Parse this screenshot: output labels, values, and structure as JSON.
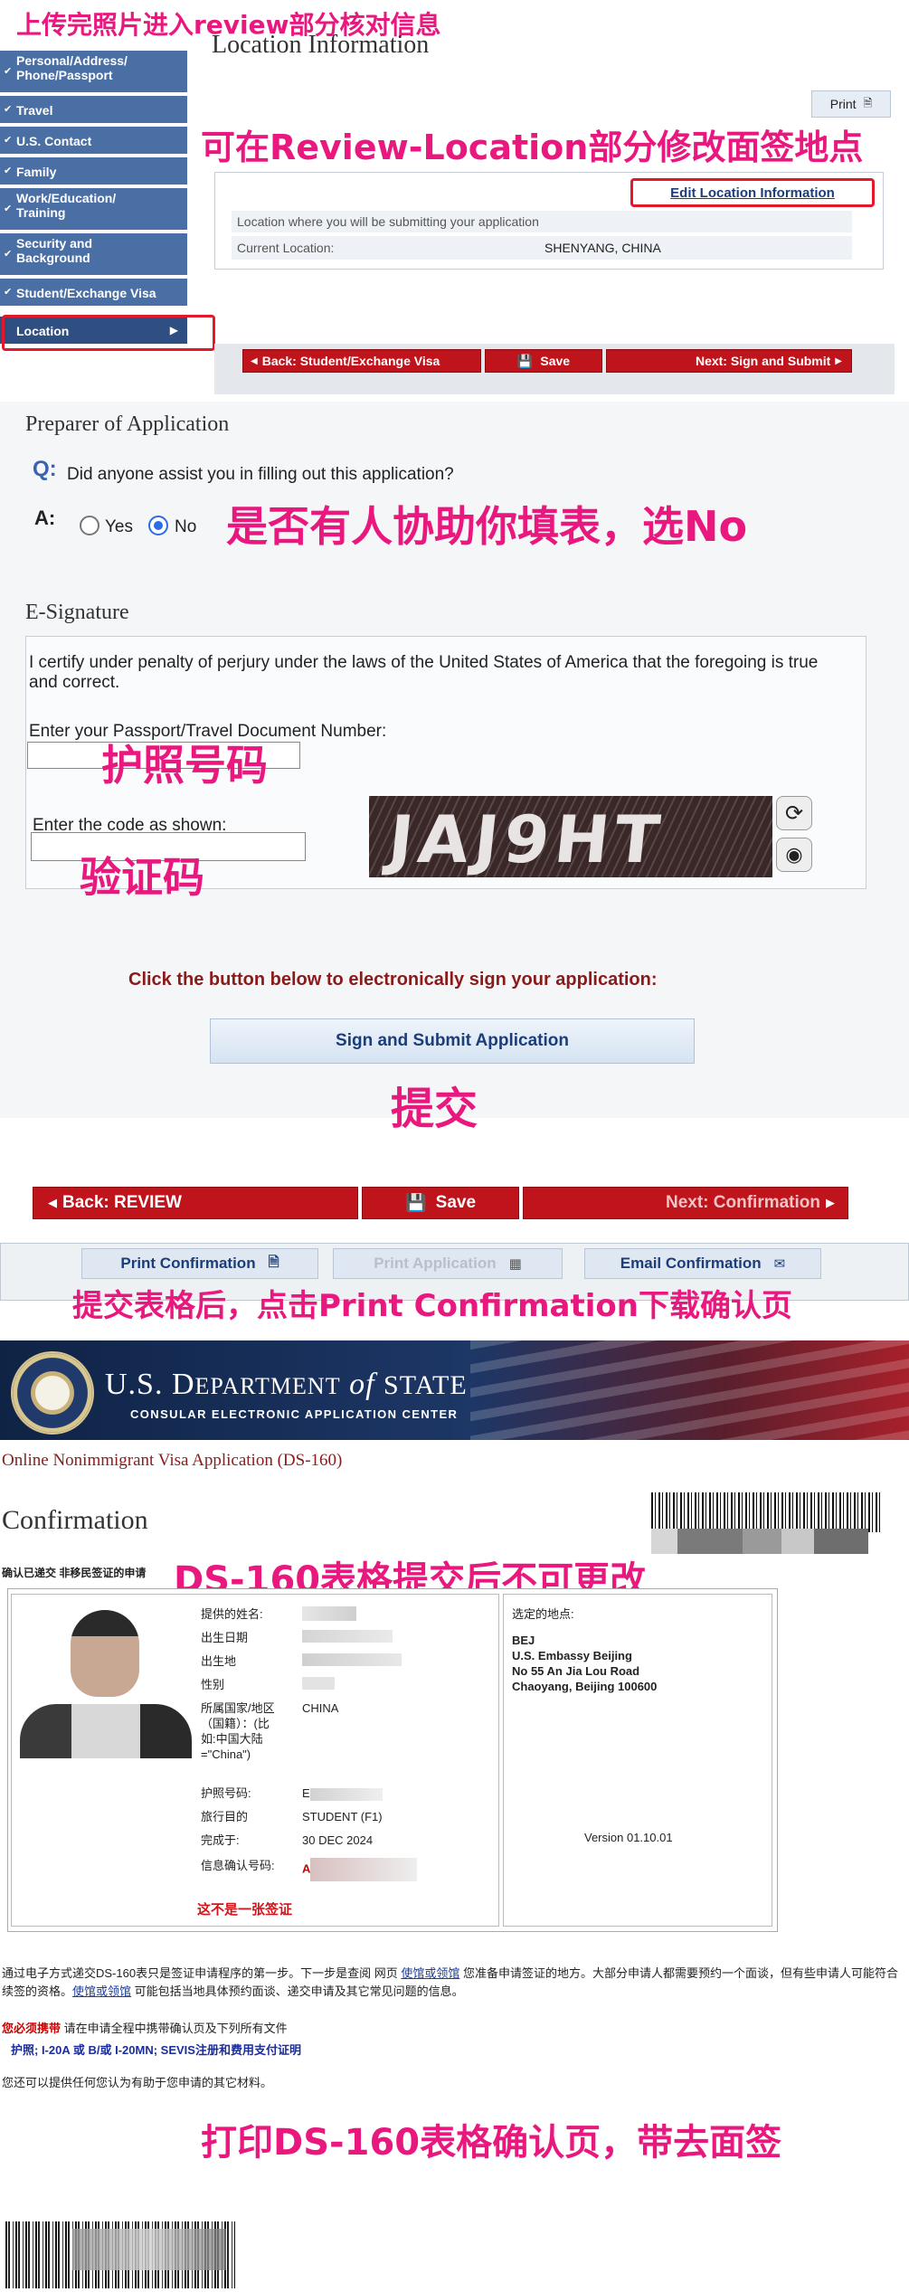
{
  "annotations": {
    "upload_review": "上传完照片进入review部分核对信息",
    "edit_location": "可在Review-Location部分修改面签地点",
    "assist_no": "是否有人协助你填表，选No",
    "passport_no": "护照号码",
    "captcha": "验证码",
    "submit": "提交",
    "print_confirmation": "提交表格后，点击Print Confirmation下载确认页",
    "no_change": "DS-160表格提交后不可更改",
    "print_bring": "打印DS-160表格确认页，带去面签"
  },
  "sidebar": {
    "items": [
      {
        "label": "Personal/Address/\nPhone/Passport"
      },
      {
        "label": "Travel"
      },
      {
        "label": "U.S. Contact"
      },
      {
        "label": "Family"
      },
      {
        "label": "Work/Education/\nTraining"
      },
      {
        "label": "Security and\nBackground"
      },
      {
        "label": "Student/Exchange Visa"
      }
    ],
    "active_label": "Location"
  },
  "location": {
    "title": "Location Information",
    "print_label": "Print",
    "edit_link": "Edit Location Information",
    "submit_location_label": "Location where you will be submitting your application",
    "current_location_label": "Current Location:",
    "current_location_value": "SHENYANG, CHINA"
  },
  "nav1": {
    "back": "Back: Student/Exchange Visa",
    "save": "Save",
    "next": "Next: Sign and Submit"
  },
  "preparer": {
    "title": "Preparer of Application",
    "q_marker": "Q:",
    "question": "Did anyone assist you in filling out this application?",
    "a_marker": "A:",
    "yes": "Yes",
    "no": "No",
    "selected": "No"
  },
  "esig": {
    "title": "E-Signature",
    "certify": "I certify under penalty of perjury under the laws of the United States of America that the foregoing is true and correct.",
    "passport_label": "Enter your Passport/Travel Document Number:",
    "code_label": "Enter the code as shown:",
    "captcha_text": "JAJ9HT",
    "click_below": "Click the button below to electronically sign your application:",
    "sign_button": "Sign and Submit Application"
  },
  "nav2": {
    "back": "Back: REVIEW",
    "save": "Save",
    "next": "Next: Confirmation"
  },
  "tabs": {
    "print_confirmation": "Print Confirmation",
    "print_application": "Print Application",
    "email_confirmation": "Email Confirmation"
  },
  "state_header": {
    "line1_prefix": "U.S. D",
    "line1_rest": "EPARTMENT",
    "of": " of ",
    "state": "STATE",
    "line2": "CONSULAR ELECTRONIC APPLICATION CENTER"
  },
  "confirmation": {
    "form_title": "Online Nonimmigrant Visa Application (DS-160)",
    "heading": "Confirmation",
    "submitted": "确认已递交 非移民签证的申请",
    "fields": [
      {
        "label": "提供的姓名:",
        "value": ""
      },
      {
        "label": "出生日期",
        "value": ""
      },
      {
        "label": "出生地",
        "value": ""
      },
      {
        "label": "性别",
        "value": ""
      },
      {
        "label": "所属国家/地区\n（国籍）：(比\n如:中国大陆\n=\"China\")",
        "value": "CHINA"
      },
      {
        "label": "护照号码:",
        "value": "E"
      },
      {
        "label": "旅行目的",
        "value": "STUDENT (F1)"
      },
      {
        "label": "完成于:",
        "value": "30 DEC 2024"
      },
      {
        "label": "信息确认号码:",
        "value": "A"
      }
    ],
    "not_visa": "这不是一张签证",
    "location_label": "选定的地点:",
    "location_code": "BEJ",
    "location_lines": [
      "U.S. Embassy Beijing",
      "No 55 An Jia Lou Road",
      "Chaoyang, Beijing 100600"
    ],
    "version": "Version 01.10.01"
  },
  "notes": {
    "para1_a": "通过电子方式递交DS-160表只是签证申请程序的第一步。下一步是查阅 网页 ",
    "link1": "使馆或领馆",
    "para1_b": " 您准备申请签证的地方。大部分申请人都需要预约一个面谈，但有些申请人可能符合续签的资格。",
    "link2": "使馆或领馆",
    "para1_c": " 可能包括当地具体预约面谈、递交申请及其它常见问题的信息。",
    "must_bring": "您必须携带",
    "must_bring_rest": " 请在申请全程中携带确认页及下列所有文件",
    "docs": "护照; I-20A 或 B/或 I-20MN; SEVIS注册和费用支付证明",
    "other": "您还可以提供任何您认为有助于您申请的其它材料。"
  },
  "colors": {
    "annotation": "#e8187f",
    "nav_blue": "#4a6fa5",
    "button_red": "#c0141c",
    "link_blue": "#1b3d7a"
  }
}
